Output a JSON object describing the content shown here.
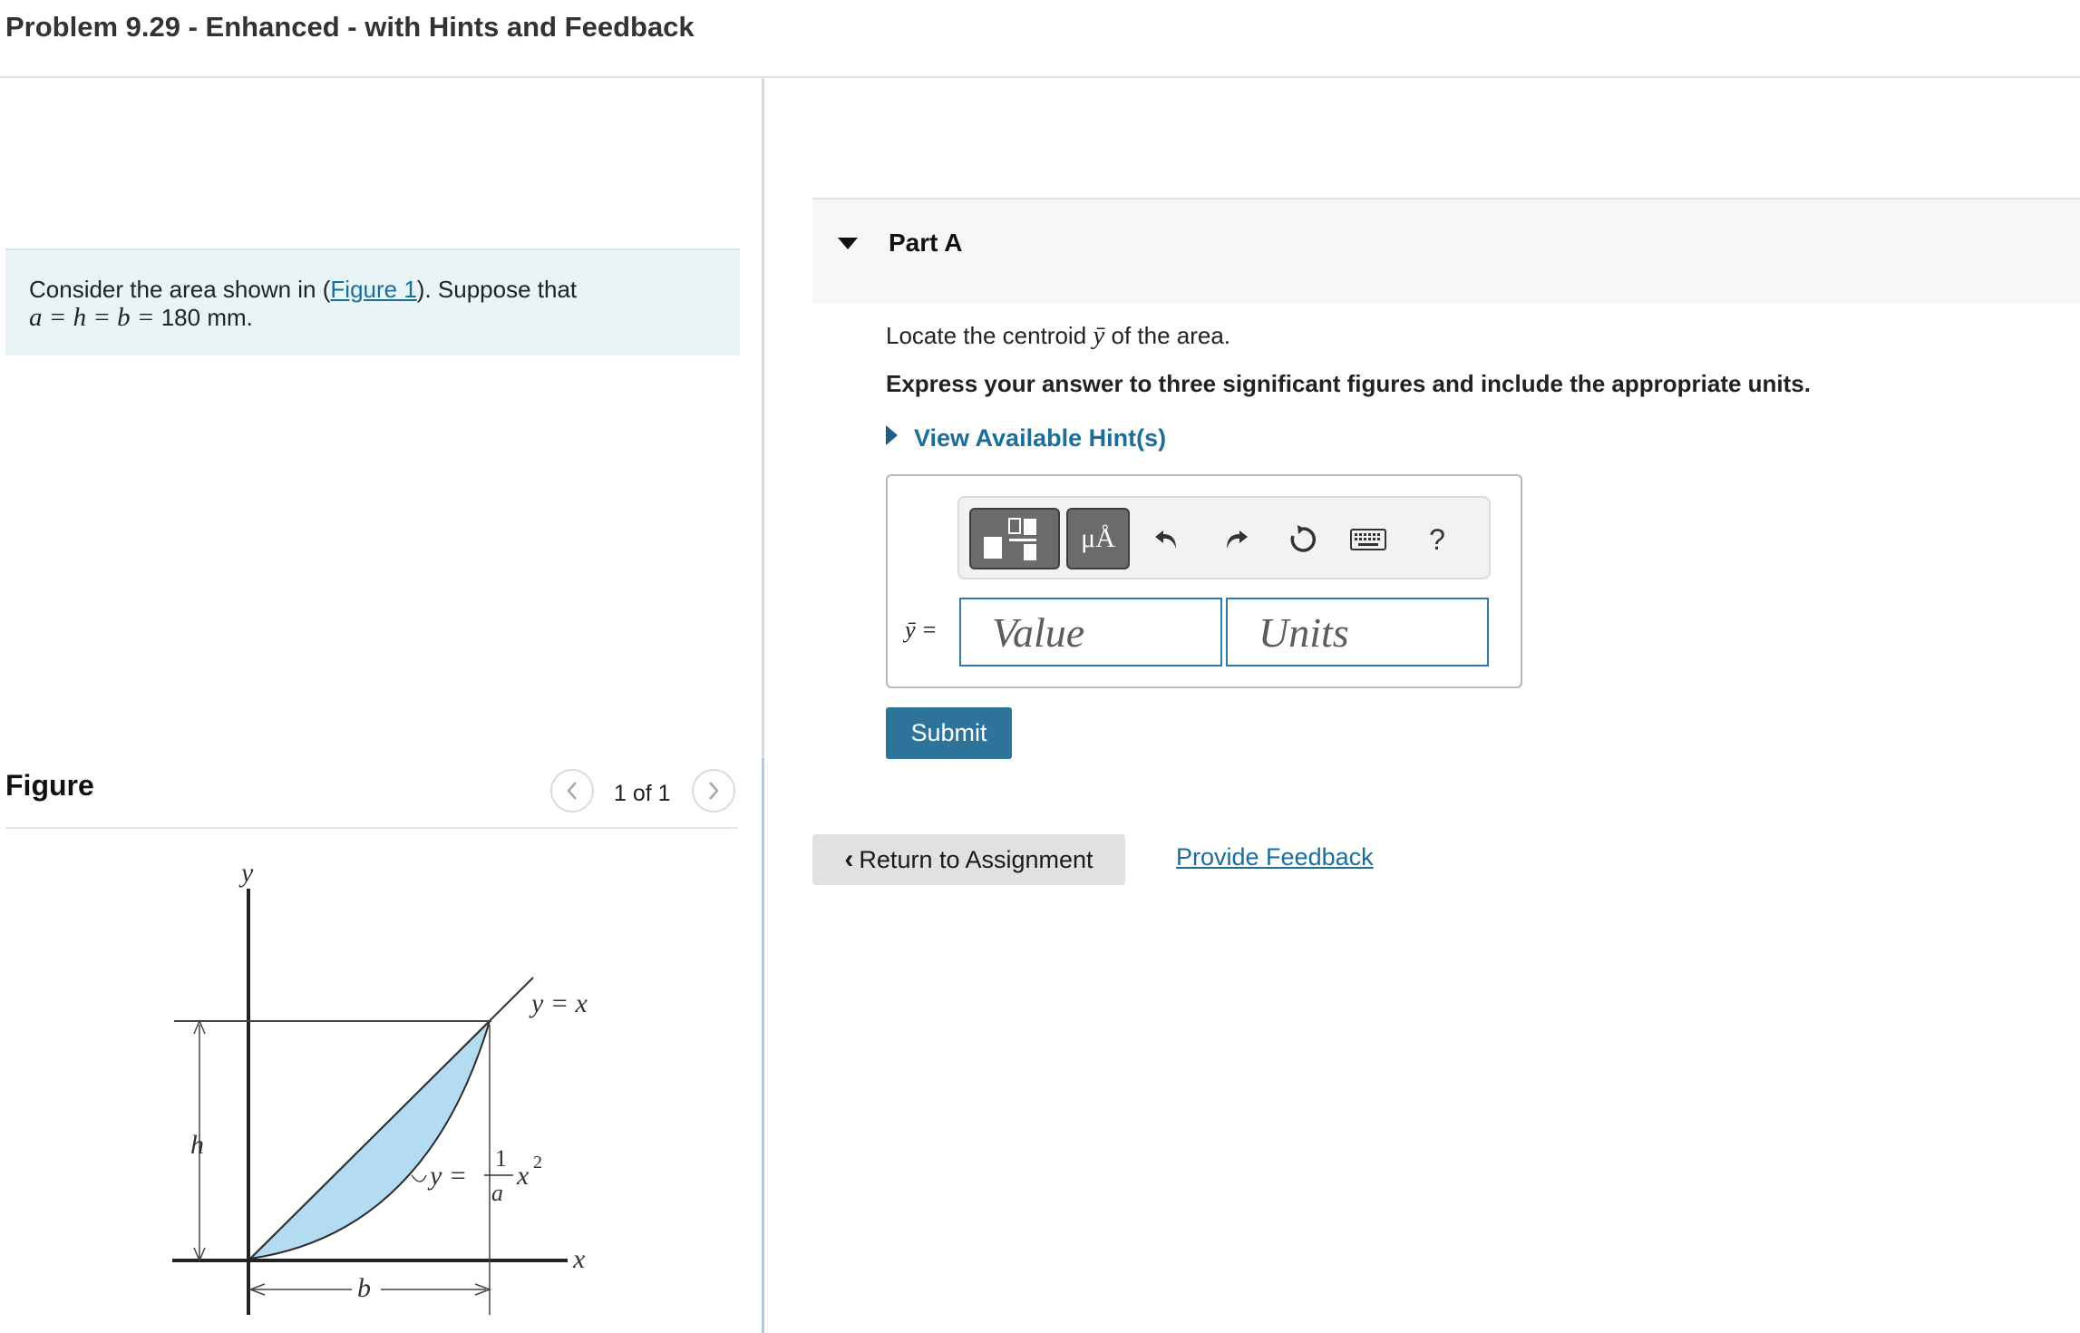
{
  "header": {
    "title": "Problem 9.29 - Enhanced - with Hints and Feedback"
  },
  "statement": {
    "text_before": "Consider the area shown in (",
    "figure_link": "Figure 1",
    "text_after": "). Suppose that",
    "equation": "a = h = b = ",
    "value_with_units": "180 mm."
  },
  "figure": {
    "heading": "Figure",
    "counter": "1 of 1",
    "labels": {
      "y_axis": "y",
      "x_axis": "x",
      "line": "y = x",
      "curve_lhs": "y =",
      "curve_num": "1",
      "curve_den": "a",
      "curve_var": "x",
      "curve_exp": "2",
      "height": "h",
      "base": "b"
    },
    "fill_color": "#b3dcf3"
  },
  "partA": {
    "title": "Part A",
    "question_before": "Locate the centroid ",
    "question_symbol": "ȳ",
    "question_after": " of the area.",
    "instruction": "Express your answer to three significant figures and include the appropriate units.",
    "hint_link": "View Available Hint(s)",
    "toolbar": {
      "symbols_label": "μÅ",
      "help_label": "?"
    },
    "answer_label": "ȳ =",
    "value_placeholder": "Value",
    "units_placeholder": "Units",
    "submit_label": "Submit"
  },
  "footer": {
    "return_label": "Return to Assignment",
    "feedback_label": "Provide Feedback"
  },
  "colors": {
    "accent": "#2e7399",
    "link": "#1b6e9a",
    "statement_bg": "#e9f4f6"
  }
}
